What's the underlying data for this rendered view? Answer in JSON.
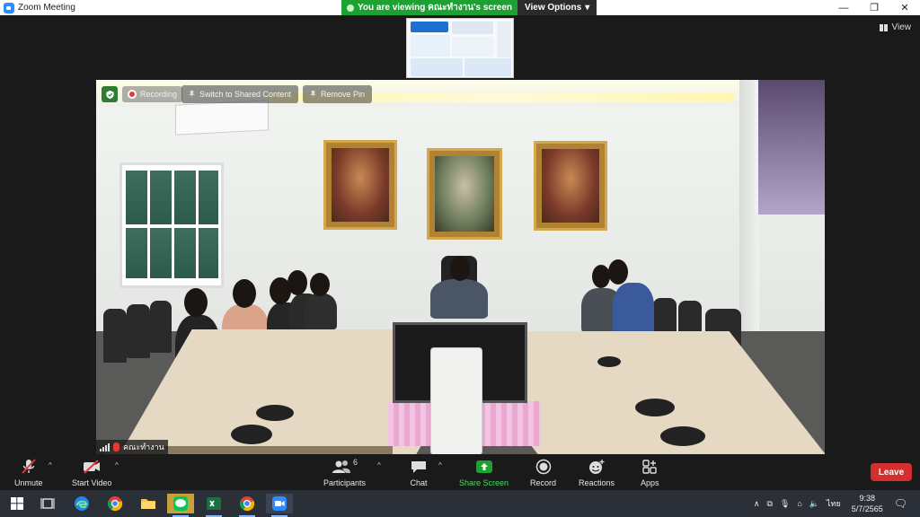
{
  "window": {
    "title": "Zoom Meeting",
    "share_banner": "You are viewing คณะทำงาน's screen",
    "view_options": "View Options",
    "controls": [
      "—",
      "❐",
      "✕"
    ]
  },
  "stage": {
    "view_label": "View"
  },
  "video_overlay": {
    "recording_label": "Recording",
    "switch_label": "Switch to Shared Content",
    "remove_pin_label": "Remove Pin",
    "participant_name": "คณะทำงาน"
  },
  "toolbar": {
    "unmute": "Unmute",
    "start_video": "Start Video",
    "participants": "Participants",
    "participants_count": "6",
    "chat": "Chat",
    "share_screen": "Share Screen",
    "record": "Record",
    "reactions": "Reactions",
    "apps": "Apps",
    "leave": "Leave"
  },
  "taskbar": {
    "language": "ไทย",
    "time": "9:38",
    "date": "5/7/2565"
  },
  "colors": {
    "share_green": "#1ea133",
    "leave_red": "#d32f2f",
    "share_screen_green": "#1ea133",
    "zoom_blue": "#2d8cff"
  }
}
